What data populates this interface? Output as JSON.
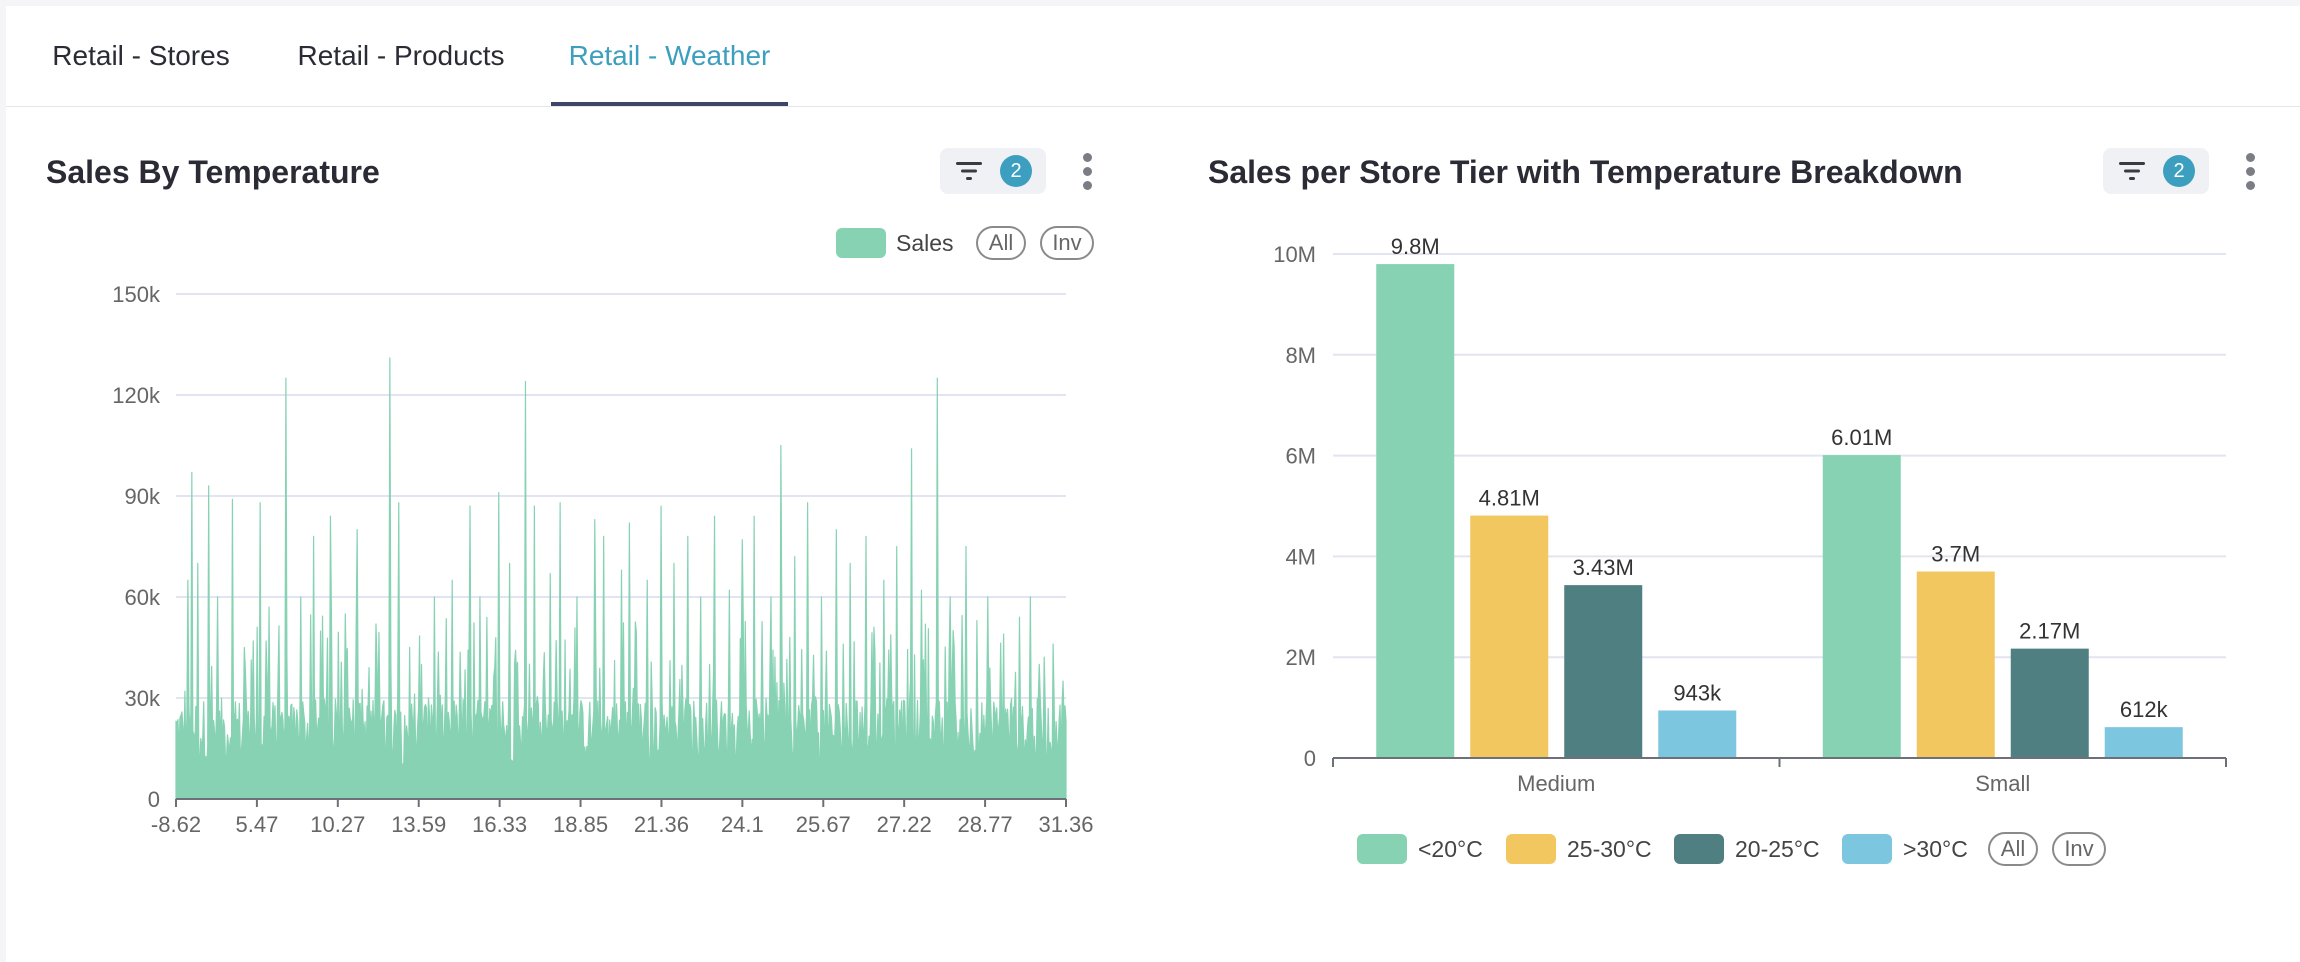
{
  "tabs": [
    {
      "label": "Retail - Stores"
    },
    {
      "label": "Retail - Products"
    },
    {
      "label": "Retail - Weather"
    }
  ],
  "colors": {
    "accent": "#3d9fbf",
    "series_sales": "#86d2b3",
    "lt20": "#86d2b3",
    "c25_30": "#f2c75f",
    "c20_25": "#4f7f80",
    "gt30": "#7dc6e0"
  },
  "left_card": {
    "title": "Sales By Temperature",
    "filter_count": "2",
    "legend_all": "All",
    "legend_inv": "Inv"
  },
  "right_card": {
    "title": "Sales per Store Tier with Temperature Breakdown",
    "filter_count": "2",
    "legend_all": "All",
    "legend_inv": "Inv"
  },
  "icons": [
    "filter-icon",
    "more-vertical-icon"
  ],
  "chart_data": [
    {
      "type": "area",
      "title": "Sales By Temperature",
      "xlabel": "",
      "ylabel": "",
      "series": [
        {
          "name": "Sales"
        }
      ],
      "x_tick_labels": [
        "-8.62",
        "5.47",
        "10.27",
        "13.59",
        "16.33",
        "18.85",
        "21.36",
        "24.1",
        "25.67",
        "27.22",
        "28.77",
        "31.36"
      ],
      "y_tick_labels": [
        "0",
        "30k",
        "60k",
        "90k",
        "120k",
        "150k"
      ],
      "ylim": [
        0,
        150000
      ],
      "baseline_range": [
        10000,
        30000
      ],
      "peaks": [
        {
          "x_frac": 0.01,
          "value": 32000
        },
        {
          "x_frac": 0.013,
          "value": 65000
        },
        {
          "x_frac": 0.018,
          "value": 97000
        },
        {
          "x_frac": 0.025,
          "value": 70000
        },
        {
          "x_frac": 0.037,
          "value": 93000
        },
        {
          "x_frac": 0.047,
          "value": 60000
        },
        {
          "x_frac": 0.063,
          "value": 89000
        },
        {
          "x_frac": 0.077,
          "value": 45000
        },
        {
          "x_frac": 0.095,
          "value": 88000
        },
        {
          "x_frac": 0.105,
          "value": 57000
        },
        {
          "x_frac": 0.124,
          "value": 125000
        },
        {
          "x_frac": 0.14,
          "value": 60000
        },
        {
          "x_frac": 0.155,
          "value": 78000
        },
        {
          "x_frac": 0.174,
          "value": 84000
        },
        {
          "x_frac": 0.19,
          "value": 55000
        },
        {
          "x_frac": 0.204,
          "value": 80000
        },
        {
          "x_frac": 0.225,
          "value": 52000
        },
        {
          "x_frac": 0.24,
          "value": 131000
        },
        {
          "x_frac": 0.25,
          "value": 88000
        },
        {
          "x_frac": 0.262,
          "value": 45000
        },
        {
          "x_frac": 0.29,
          "value": 60000
        },
        {
          "x_frac": 0.31,
          "value": 65000
        },
        {
          "x_frac": 0.33,
          "value": 87000
        },
        {
          "x_frac": 0.342,
          "value": 60000
        },
        {
          "x_frac": 0.363,
          "value": 91000
        },
        {
          "x_frac": 0.375,
          "value": 70000
        },
        {
          "x_frac": 0.393,
          "value": 124000
        },
        {
          "x_frac": 0.403,
          "value": 87000
        },
        {
          "x_frac": 0.42,
          "value": 67000
        },
        {
          "x_frac": 0.432,
          "value": 88000
        },
        {
          "x_frac": 0.45,
          "value": 60000
        },
        {
          "x_frac": 0.47,
          "value": 83000
        },
        {
          "x_frac": 0.48,
          "value": 78000
        },
        {
          "x_frac": 0.5,
          "value": 68000
        },
        {
          "x_frac": 0.51,
          "value": 82000
        },
        {
          "x_frac": 0.53,
          "value": 65000
        },
        {
          "x_frac": 0.545,
          "value": 87000
        },
        {
          "x_frac": 0.56,
          "value": 70000
        },
        {
          "x_frac": 0.575,
          "value": 78000
        },
        {
          "x_frac": 0.59,
          "value": 60000
        },
        {
          "x_frac": 0.605,
          "value": 84000
        },
        {
          "x_frac": 0.622,
          "value": 62000
        },
        {
          "x_frac": 0.636,
          "value": 77000
        },
        {
          "x_frac": 0.65,
          "value": 84000
        },
        {
          "x_frac": 0.668,
          "value": 60000
        },
        {
          "x_frac": 0.68,
          "value": 105000
        },
        {
          "x_frac": 0.695,
          "value": 72000
        },
        {
          "x_frac": 0.71,
          "value": 88000
        },
        {
          "x_frac": 0.725,
          "value": 60000
        },
        {
          "x_frac": 0.742,
          "value": 80000
        },
        {
          "x_frac": 0.758,
          "value": 70000
        },
        {
          "x_frac": 0.775,
          "value": 78000
        },
        {
          "x_frac": 0.795,
          "value": 65000
        },
        {
          "x_frac": 0.81,
          "value": 75000
        },
        {
          "x_frac": 0.826,
          "value": 104000
        },
        {
          "x_frac": 0.838,
          "value": 62000
        },
        {
          "x_frac": 0.855,
          "value": 78000
        },
        {
          "x_frac": 0.87,
          "value": 60000
        },
        {
          "x_frac": 0.888,
          "value": 75000
        },
        {
          "x_frac": 0.9,
          "value": 53000
        },
        {
          "x_frac": 0.912,
          "value": 60000
        },
        {
          "x_frac": 0.93,
          "value": 49000
        },
        {
          "x_frac": 0.948,
          "value": 54000
        },
        {
          "x_frac": 0.96,
          "value": 60000
        },
        {
          "x_frac": 0.97,
          "value": 40000
        },
        {
          "x_frac": 0.985,
          "value": 46000
        },
        {
          "x_frac": 0.995,
          "value": 28000
        }
      ],
      "spike_at": {
        "x_frac": 0.855,
        "value": 125000
      },
      "legend": "top-right",
      "grid": true
    },
    {
      "type": "bar",
      "title": "Sales per Store Tier with Temperature Breakdown",
      "categories": [
        "Medium",
        "Small"
      ],
      "series": [
        {
          "name": "<20°C",
          "values": [
            9800000,
            6010000
          ],
          "labels": [
            "9.8M",
            "6.01M"
          ],
          "color": "#86d2b3"
        },
        {
          "name": "25-30°C",
          "values": [
            4810000,
            3700000
          ],
          "labels": [
            "4.81M",
            "3.7M"
          ],
          "color": "#f2c75f"
        },
        {
          "name": "20-25°C",
          "values": [
            3430000,
            2170000
          ],
          "labels": [
            "3.43M",
            "2.17M"
          ],
          "color": "#4f7f80"
        },
        {
          "name": ">30°C",
          "values": [
            943000,
            612000
          ],
          "labels": [
            "943k",
            "612k"
          ],
          "color": "#7dc6e0"
        }
      ],
      "y_tick_labels": [
        "0",
        "2M",
        "4M",
        "6M",
        "8M",
        "10M"
      ],
      "ylim": [
        0,
        10000000
      ],
      "xlabel": "",
      "ylabel": "",
      "legend": "bottom",
      "grid": true
    }
  ]
}
